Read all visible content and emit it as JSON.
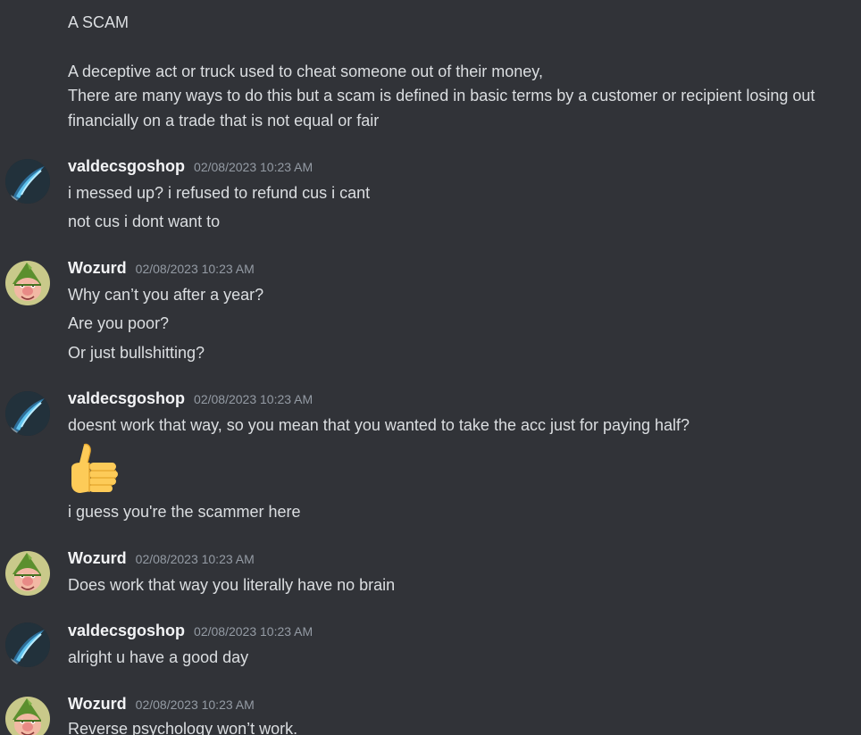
{
  "intro": {
    "heading": "A SCAM",
    "line1": "A deceptive act or truck used to cheat someone out of their money,",
    "line2": "There are many ways to do this but a scam is defined in basic terms by a customer or recipient losing out",
    "line3": "financially on a trade that is not equal or fair"
  },
  "messages": [
    {
      "author": "valdecsgoshop",
      "avatar": "blue-blade-avatar",
      "timestamp": "02/08/2023 10:23 AM",
      "lines": [
        "i messed up? i refused to refund cus i cant",
        "not cus i dont want to"
      ]
    },
    {
      "author": "Wozurd",
      "avatar": "green-gnome-avatar",
      "timestamp": "02/08/2023 10:23 AM",
      "lines": [
        "Why can’t you after a year?",
        "Are you poor?",
        "Or just bullshitting?"
      ]
    },
    {
      "author": "valdecsgoshop",
      "avatar": "blue-blade-avatar",
      "timestamp": "02/08/2023 10:23 AM",
      "lines": [
        "doesnt work that way, so you mean that you wanted to take the acc just for paying half?",
        "i guess you're the scammer here"
      ],
      "emoji": "thumbs-up-emoji"
    },
    {
      "author": "Wozurd",
      "avatar": "green-gnome-avatar",
      "timestamp": "02/08/2023 10:23 AM",
      "lines": [
        "Does work that way you literally have no brain"
      ]
    },
    {
      "author": "valdecsgoshop",
      "avatar": "blue-blade-avatar",
      "timestamp": "02/08/2023 10:23 AM",
      "lines": [
        "alright u have a good day"
      ]
    },
    {
      "author": "Wozurd",
      "avatar": "green-gnome-avatar",
      "timestamp": "02/08/2023 10:23 AM",
      "lines": [
        "Reverse psychology won’t work."
      ]
    }
  ],
  "colors": {
    "background": "#313338",
    "text": "#dbdee1",
    "username": "#f2f3f5",
    "timestamp": "#949ba4"
  }
}
